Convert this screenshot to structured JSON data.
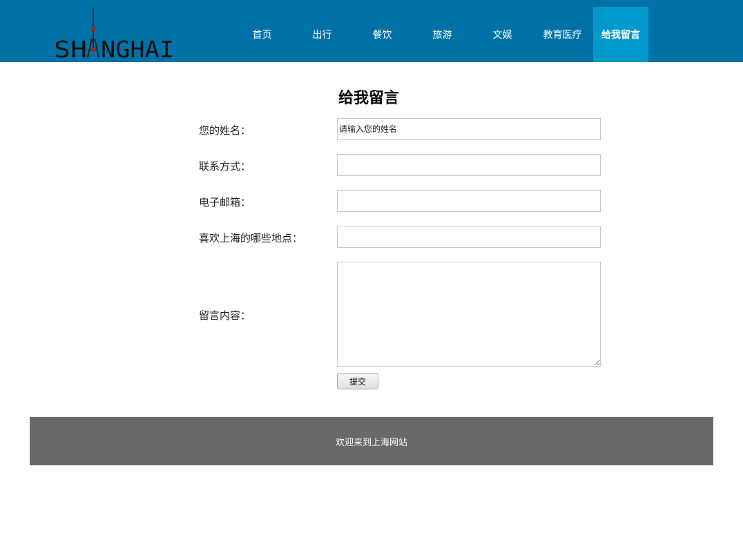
{
  "header": {
    "logo_text": "SHANGHAI",
    "colors": {
      "bar": "#0071a6",
      "active_tab": "#0099cc"
    },
    "nav": [
      {
        "label": "首页"
      },
      {
        "label": "出行"
      },
      {
        "label": "餐饮"
      },
      {
        "label": "旅游"
      },
      {
        "label": "文娱"
      },
      {
        "label": "教育医疗"
      },
      {
        "label": "给我留言",
        "active": true
      }
    ]
  },
  "form": {
    "title": "给我留言",
    "name_label": "您的姓名：",
    "name_placeholder": "请输入您的姓名",
    "contact_label": "联系方式：",
    "email_label": "电子邮箱：",
    "places_label": "喜欢上海的哪些地点：",
    "message_label": "留言内容：",
    "submit_label": "提交"
  },
  "footer": {
    "text": "欢迎来到上海网站",
    "color": "#696969"
  }
}
